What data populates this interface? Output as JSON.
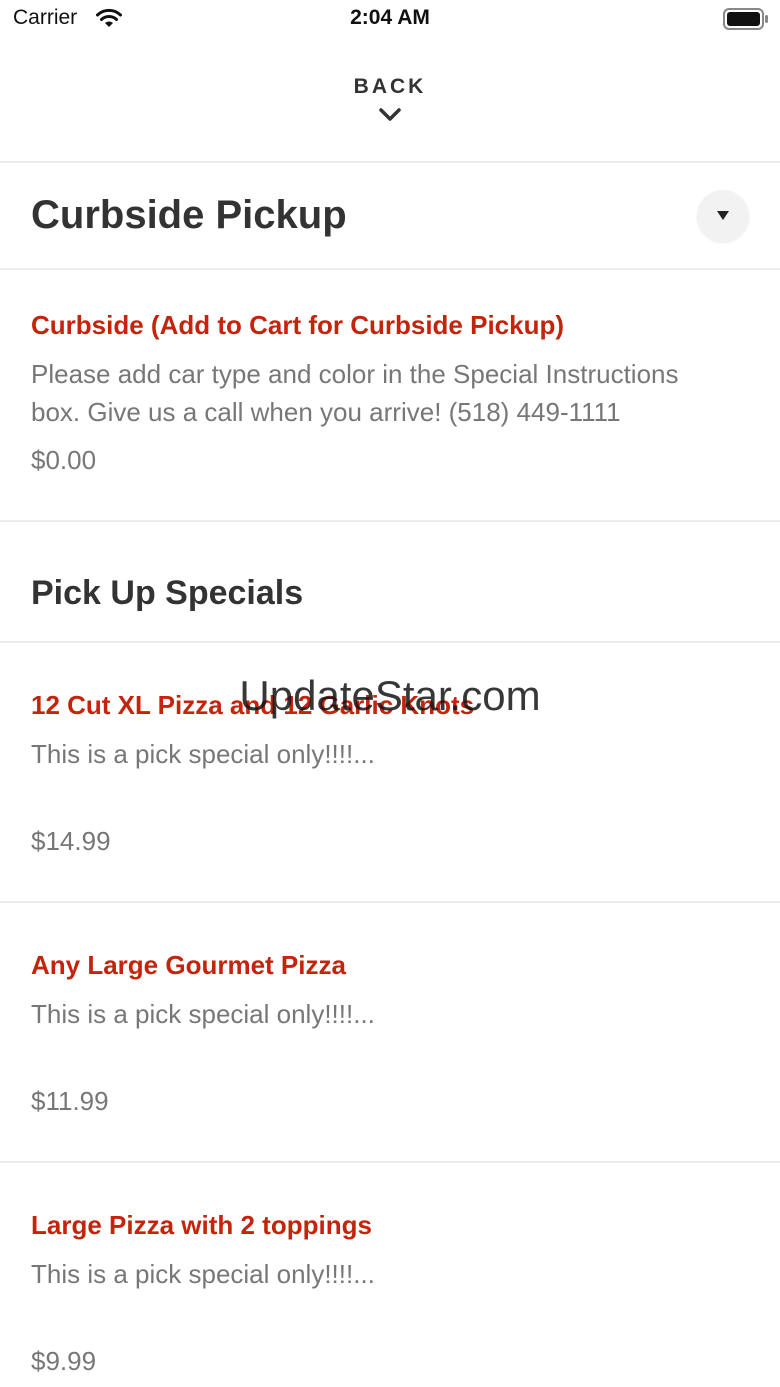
{
  "status_bar": {
    "carrier": "Carrier",
    "time": "2:04 AM",
    "icons": [
      "wifi-icon",
      "battery-icon"
    ]
  },
  "nav": {
    "back_label": "BACK",
    "back_icon": "chevron-down-icon"
  },
  "sections": {
    "curbside": {
      "title": "Curbside Pickup",
      "toggle_icon": "triangle-down-icon",
      "items": [
        {
          "name": "Curbside (Add to Cart for Curbside Pickup)",
          "description": "Please add car type and color in the Special Instructions box. Give us a call when you arrive! (518) 449-1111",
          "price": "$0.00"
        }
      ]
    },
    "pickup_specials": {
      "title": "Pick Up Specials",
      "items": [
        {
          "name": "12 Cut XL Pizza and 12 Garlic Knots",
          "description": "This is a pick special only!!!!...",
          "price": "$14.99"
        },
        {
          "name": "Any Large Gourmet Pizza",
          "description": "This is a pick special only!!!!...",
          "price": "$11.99"
        },
        {
          "name": "Large Pizza with 2 toppings",
          "description": "This is a pick special only!!!!...",
          "price": "$9.99"
        }
      ]
    }
  },
  "watermark": "UpdateStar.com",
  "colors": {
    "accent": "#c4240c",
    "muted_text": "#777777",
    "heading_text": "#333333",
    "divider": "#ececec"
  }
}
